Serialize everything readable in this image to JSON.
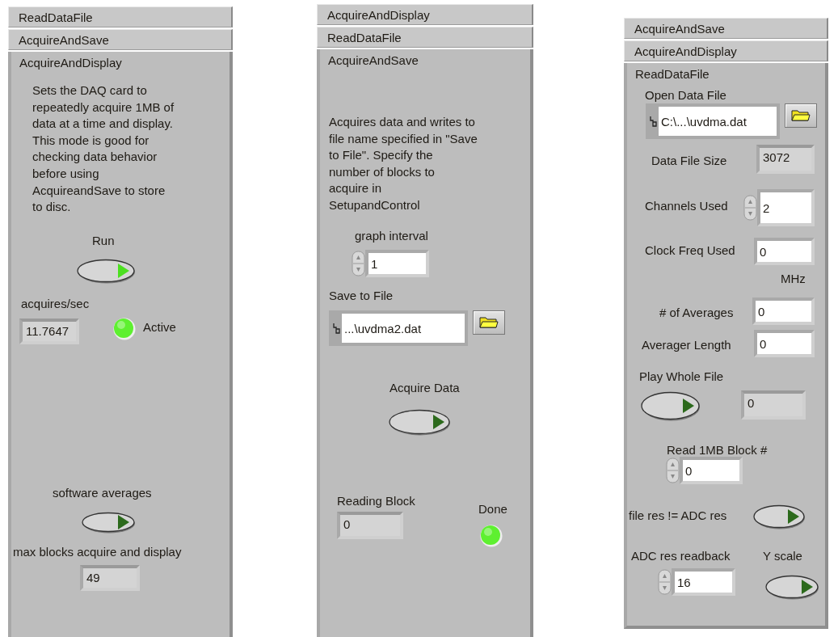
{
  "panels": [
    {
      "tabs": [
        {
          "label": "ReadDataFile",
          "selected": false
        },
        {
          "label": "AcquireAndSave",
          "selected": false
        },
        {
          "label": "AcquireAndDisplay",
          "selected": true
        }
      ],
      "items": [
        {
          "kind": "description",
          "text": "Sets the DAQ card to\nrepeatedly acquire 1MB of\ndata at a time and display.\nThis mode is good for\nchecking data behavior\nbefore using\nAcquireandSave to store\nto disc."
        },
        {
          "kind": "label",
          "text": "Run"
        },
        {
          "kind": "switch",
          "on": true
        },
        {
          "kind": "label",
          "text": "acquires/sec"
        },
        {
          "kind": "display",
          "value": "11.7647"
        },
        {
          "kind": "led",
          "on": true
        },
        {
          "kind": "label",
          "text": "Active"
        },
        {
          "kind": "label",
          "text": "software averages"
        },
        {
          "kind": "switch",
          "on": false
        },
        {
          "kind": "label",
          "text": "max blocks acquire and display"
        },
        {
          "kind": "display",
          "value": "49"
        }
      ]
    },
    {
      "tabs": [
        {
          "label": "AcquireAndDisplay",
          "selected": false
        },
        {
          "label": "ReadDataFile",
          "selected": false
        },
        {
          "label": "AcquireAndSave",
          "selected": true
        }
      ],
      "items": [
        {
          "kind": "description",
          "text": "Acquires data and writes to\nfile name specified in \"Save\nto File\". Specify the\nnumber of blocks to\nacquire in\nSetupandControl"
        },
        {
          "kind": "label",
          "text": "graph interval"
        },
        {
          "kind": "entry",
          "value": "1",
          "spinner": true
        },
        {
          "kind": "label",
          "text": "Save to File"
        },
        {
          "kind": "path",
          "value": "...\\uvdma2.dat"
        },
        {
          "kind": "label",
          "text": "Acquire Data"
        },
        {
          "kind": "switch",
          "on": false
        },
        {
          "kind": "label",
          "text": "Reading Block"
        },
        {
          "kind": "display",
          "value": "0"
        },
        {
          "kind": "label",
          "text": "Done"
        },
        {
          "kind": "led",
          "on": true
        }
      ]
    },
    {
      "tabs": [
        {
          "label": "AcquireAndSave",
          "selected": false
        },
        {
          "label": "AcquireAndDisplay",
          "selected": false
        },
        {
          "label": "ReadDataFile",
          "selected": true
        }
      ],
      "items": [
        {
          "kind": "label",
          "text": "Open Data File"
        },
        {
          "kind": "path",
          "value": "C:\\...\\uvdma.dat"
        },
        {
          "kind": "label",
          "text": "Data File Size"
        },
        {
          "kind": "display",
          "value": "3072"
        },
        {
          "kind": "label",
          "text": "Channels Used"
        },
        {
          "kind": "entry",
          "value": "2",
          "spinner": true
        },
        {
          "kind": "label",
          "text": "Clock Freq Used"
        },
        {
          "kind": "entry",
          "value": "0",
          "spinner": false
        },
        {
          "kind": "label",
          "text": "MHz"
        },
        {
          "kind": "label",
          "text": "# of Averages"
        },
        {
          "kind": "entry",
          "value": "0",
          "spinner": false
        },
        {
          "kind": "label",
          "text": "Averager Length"
        },
        {
          "kind": "entry",
          "value": "0",
          "spinner": false
        },
        {
          "kind": "label",
          "text": "Play Whole File"
        },
        {
          "kind": "switch",
          "on": false
        },
        {
          "kind": "display",
          "value": "0"
        },
        {
          "kind": "label",
          "text": "Read 1MB Block #"
        },
        {
          "kind": "entry",
          "value": "0",
          "spinner": true
        },
        {
          "kind": "label",
          "text": "file res != ADC res"
        },
        {
          "kind": "switch",
          "on": false
        },
        {
          "kind": "label",
          "text": "ADC res readback"
        },
        {
          "kind": "entry",
          "value": "16",
          "spinner": true
        },
        {
          "kind": "label",
          "text": "Y scale"
        },
        {
          "kind": "switch",
          "on": false
        }
      ]
    }
  ]
}
